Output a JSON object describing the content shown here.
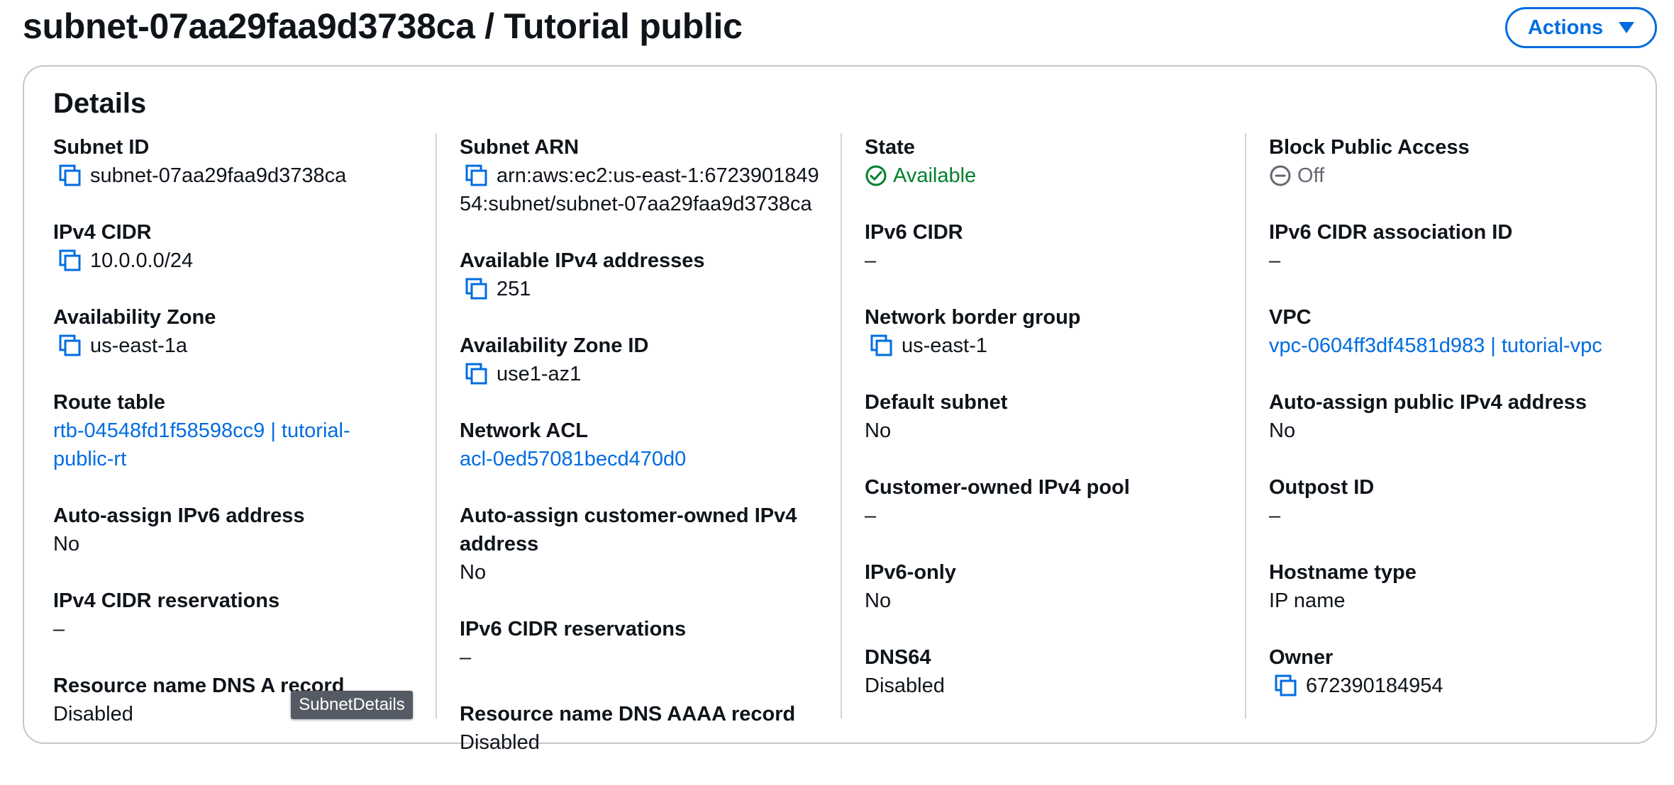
{
  "page": {
    "title": "subnet-07aa29faa9d3738ca / Tutorial public",
    "actions_label": "Actions"
  },
  "panel": {
    "title": "Details"
  },
  "col1": {
    "subnet_id": {
      "label": "Subnet ID",
      "value": "subnet-07aa29faa9d3738ca"
    },
    "ipv4_cidr": {
      "label": "IPv4 CIDR",
      "value": "10.0.0.0/24"
    },
    "az": {
      "label": "Availability Zone",
      "value": "us-east-1a"
    },
    "route_table": {
      "label": "Route table",
      "value_line1": "rtb-04548fd1f58598cc9 | tutorial-",
      "value_line2": "public-rt"
    },
    "auto_ipv6": {
      "label": "Auto-assign IPv6 address",
      "value": "No"
    },
    "ipv4_reservations": {
      "label": "IPv4 CIDR reservations",
      "value": "–"
    },
    "dns_a": {
      "label": "Resource name DNS A record",
      "value": "Disabled"
    }
  },
  "col2": {
    "subnet_arn": {
      "label": "Subnet ARN",
      "value_line1": "arn:aws:ec2:us-east-1:6723901849",
      "value_line2": "54:subnet/subnet-07aa29faa9d3738ca"
    },
    "available_ipv4": {
      "label": "Available IPv4 addresses",
      "value": "251"
    },
    "az_id": {
      "label": "Availability Zone ID",
      "value": "use1-az1"
    },
    "network_acl": {
      "label": "Network ACL",
      "value": "acl-0ed57081becd470d0"
    },
    "auto_customer_ipv4": {
      "label_line1": "Auto-assign customer-owned IPv4",
      "label_line2": "address",
      "value": "No"
    },
    "ipv6_reservations": {
      "label": "IPv6 CIDR reservations",
      "value": "–"
    },
    "dns_aaaa": {
      "label": "Resource name DNS AAAA record",
      "value": "Disabled"
    }
  },
  "col3": {
    "state": {
      "label": "State",
      "value": "Available"
    },
    "ipv6_cidr": {
      "label": "IPv6 CIDR",
      "value": "–"
    },
    "border_group": {
      "label": "Network border group",
      "value": "us-east-1"
    },
    "default_subnet": {
      "label": "Default subnet",
      "value": "No"
    },
    "customer_pool": {
      "label": "Customer-owned IPv4 pool",
      "value": "–"
    },
    "ipv6_only": {
      "label": "IPv6-only",
      "value": "No"
    },
    "dns64": {
      "label": "DNS64",
      "value": "Disabled"
    }
  },
  "col4": {
    "bpa": {
      "label": "Block Public Access",
      "value": "Off"
    },
    "ipv6_assoc": {
      "label": "IPv6 CIDR association ID",
      "value": "–"
    },
    "vpc": {
      "label": "VPC",
      "value": "vpc-0604ff3df4581d983 | tutorial-vpc"
    },
    "auto_public_ipv4": {
      "label": "Auto-assign public IPv4 address",
      "value": "No"
    },
    "outpost": {
      "label": "Outpost ID",
      "value": "–"
    },
    "hostname_type": {
      "label": "Hostname type",
      "value": "IP name"
    },
    "owner": {
      "label": "Owner",
      "value": "672390184954"
    }
  },
  "tooltip": {
    "text": "SubnetDetails"
  },
  "colors": {
    "link": "#006ce0",
    "success": "#00802f",
    "muted": "#656871",
    "border": "#c6c6cd",
    "tooltip_bg": "#545b64"
  },
  "icons": {
    "copy": "copy-icon",
    "status_available": "check-circle-icon",
    "status_off": "minus-circle-icon",
    "actions_caret": "caret-down-icon"
  }
}
